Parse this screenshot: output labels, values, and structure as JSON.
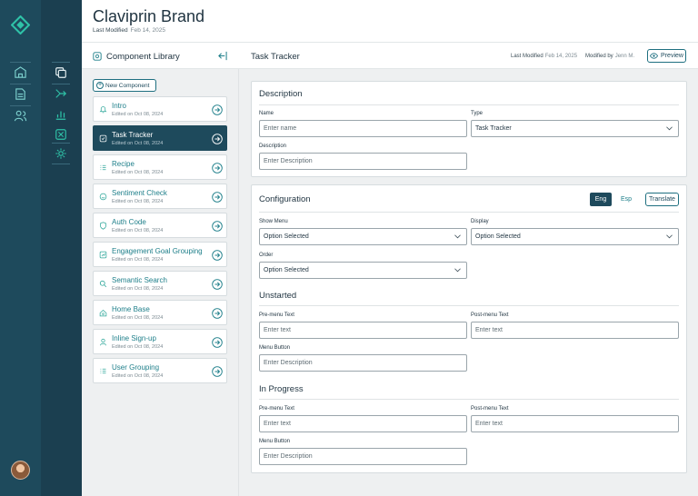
{
  "header": {
    "brand_title": "Claviprin Brand",
    "last_modified_label": "Last Modified",
    "last_modified_value": "Feb 14, 2025"
  },
  "rail_primary": {
    "icons": [
      "building-icon",
      "document-icon",
      "users-icon"
    ]
  },
  "rail_secondary": {
    "icons": [
      "copy-icon",
      "flow-icon",
      "bar-chart-icon",
      "component-icon",
      "settings-icon"
    ]
  },
  "library": {
    "title": "Component Library",
    "new_button": "New Component",
    "items": [
      {
        "name": "Intro",
        "edited": "Edited on Oct 08, 2024",
        "icon": "bell-icon"
      },
      {
        "name": "Task Tracker",
        "edited": "Edited on Oct 08, 2024",
        "icon": "task-icon",
        "active": true
      },
      {
        "name": "Recipe",
        "edited": "Edited on Oct 08, 2024",
        "icon": "list-icon"
      },
      {
        "name": "Sentiment Check",
        "edited": "Edited on Oct 08, 2024",
        "icon": "smile-icon"
      },
      {
        "name": "Auth Code",
        "edited": "Edited on Oct 08, 2024",
        "icon": "shield-icon"
      },
      {
        "name": "Engagement Goal Grouping",
        "edited": "Edited on Oct 08, 2024",
        "icon": "chart-icon"
      },
      {
        "name": "Semantic Search",
        "edited": "Edited on Oct 08, 2024",
        "icon": "search-icon"
      },
      {
        "name": "Home Base",
        "edited": "Edited on Oct 08, 2024",
        "icon": "home-icon"
      },
      {
        "name": "Inline Sign-up",
        "edited": "Edited on Oct 08, 2024",
        "icon": "user-icon"
      },
      {
        "name": "User Grouping",
        "edited": "Edited on Oct 08, 2024",
        "icon": "list-icon"
      }
    ]
  },
  "main": {
    "title": "Task Tracker",
    "last_modified_label": "Last Modified",
    "last_modified_value": "Feb 14, 2025",
    "modified_by_label": "Modified by",
    "modified_by_value": "Jenn M.",
    "preview_label": "Preview",
    "description_card": {
      "title": "Description",
      "name_label": "Name",
      "name_placeholder": "Enter name",
      "type_label": "Type",
      "type_value": "Task Tracker",
      "description_label": "Description",
      "description_placeholder": "Enter Description"
    },
    "configuration_card": {
      "title": "Configuration",
      "lang_eng": "Eng",
      "lang_esp": "Esp",
      "translate_label": "Translate",
      "show_menu_label": "Show Menu",
      "show_menu_value": "Option Selected",
      "display_label": "Display",
      "display_value": "Option Selected",
      "order_label": "Order",
      "order_value": "Option Selected",
      "unstarted": {
        "title": "Unstarted",
        "pre_menu_label": "Pre-menu Text",
        "pre_menu_placeholder": "Enter text",
        "post_menu_label": "Post-menu Text",
        "post_menu_placeholder": "Enter text",
        "menu_button_label": "Menu Button",
        "menu_button_placeholder": "Enter Description"
      },
      "in_progress": {
        "title": "In Progress",
        "pre_menu_label": "Pre-menu Text",
        "pre_menu_placeholder": "Enter text",
        "post_menu_label": "Post-menu Text",
        "post_menu_placeholder": "Enter text",
        "menu_button_label": "Menu Button",
        "menu_button_placeholder": "Enter Description"
      }
    }
  },
  "colors": {
    "rail_dark": "#1b3f50",
    "rail": "#1e4a5c",
    "accent": "#1e7f8a",
    "active_item": "#1e4a5c"
  }
}
